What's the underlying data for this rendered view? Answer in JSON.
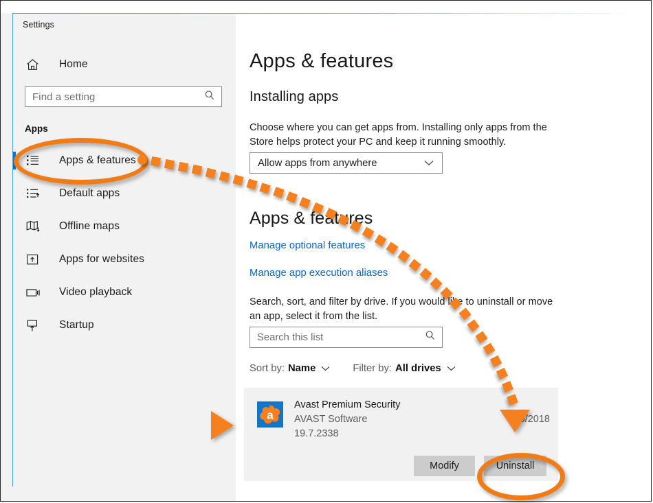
{
  "window": {
    "app_title": "Settings"
  },
  "sidebar": {
    "home_label": "Home",
    "home_icon": "home-icon",
    "search": {
      "placeholder": "Find a setting",
      "value": "",
      "icon": "search-icon"
    },
    "section_label": "Apps",
    "items": [
      {
        "label": "Apps & features",
        "icon": "list-bullets-icon",
        "selected": true
      },
      {
        "label": "Default apps",
        "icon": "list-arrow-icon",
        "selected": false
      },
      {
        "label": "Offline maps",
        "icon": "map-download-icon",
        "selected": false
      },
      {
        "label": "Apps for websites",
        "icon": "window-arrow-icon",
        "selected": false
      },
      {
        "label": "Video playback",
        "icon": "video-camera-icon",
        "selected": false
      },
      {
        "label": "Startup",
        "icon": "monitor-arrow-icon",
        "selected": false
      }
    ]
  },
  "main": {
    "page_title": "Apps & features",
    "installing_apps": {
      "heading": "Installing apps",
      "description": "Choose where you can get apps from. Installing only apps from the Store helps protect your PC and keep it running smoothly.",
      "dropdown_value": "Allow apps from anywhere",
      "dropdown_icon": "chevron-down-icon"
    },
    "apps_features": {
      "heading": "Apps & features",
      "links": [
        "Manage optional features",
        "Manage app execution aliases"
      ],
      "description": "Search, sort, and filter by drive. If you would like to uninstall or move an app, select it from the list.",
      "search": {
        "placeholder": "Search this list",
        "value": "",
        "icon": "search-icon"
      },
      "sort_label": "Sort by:",
      "sort_value": "Name",
      "filter_label": "Filter by:",
      "filter_value": "All drives",
      "chevron_icon": "chevron-down-icon"
    },
    "app_list": [
      {
        "name": "Avast Premium Security",
        "publisher": "AVAST Software",
        "version": "19.7.2338",
        "install_date": "0/2018",
        "icon": "avast-icon",
        "buttons": [
          "Modify",
          "Uninstall"
        ],
        "selected": true
      }
    ]
  },
  "annotations": {
    "accent_color": "#f5801f",
    "highlight_sidebar_item": "Apps & features",
    "highlight_button": "Uninstall",
    "pointer_to_app": "Avast Premium Security",
    "arrow_style": "dotted-curve"
  },
  "colors": {
    "accent_orange": "#f5801f",
    "selection_blue": "#0078d7",
    "link_blue": "#0066cc",
    "sidebar_bg": "#f0f0f0",
    "row_bg": "#f1f1f1",
    "button_bg": "#cccccc",
    "avast_blue": "#1175c9"
  }
}
